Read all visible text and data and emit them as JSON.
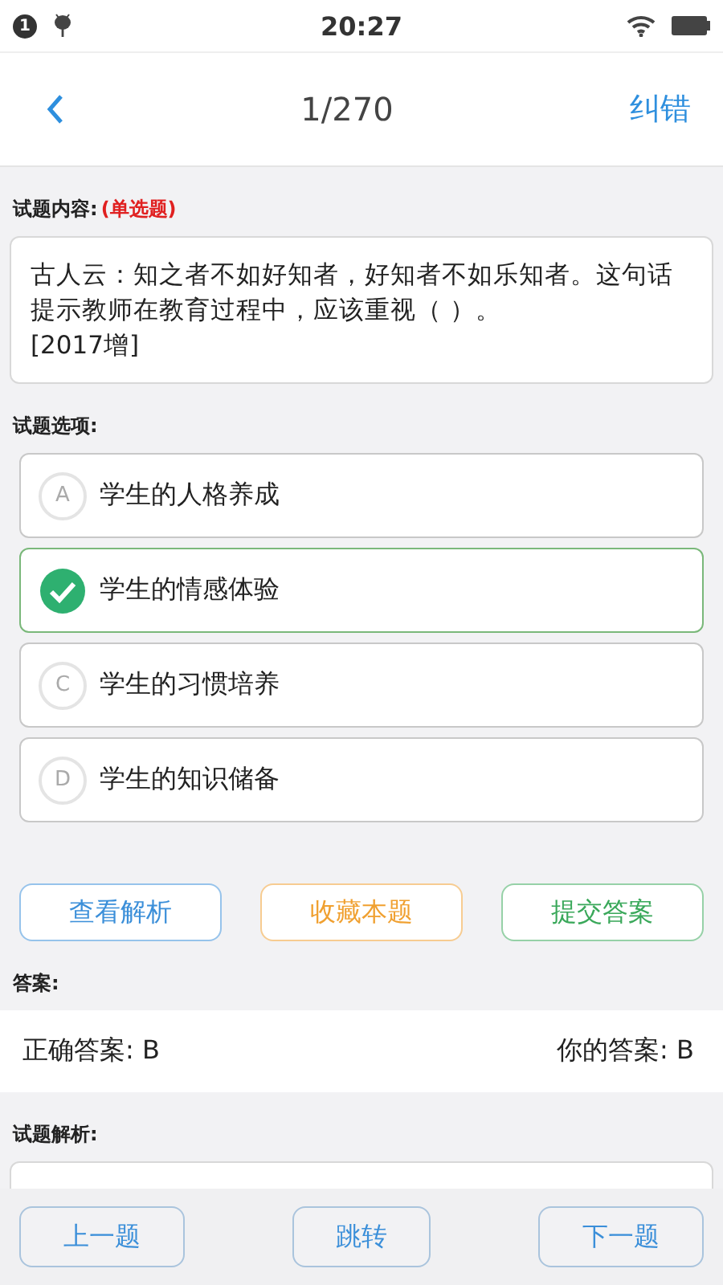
{
  "status_bar": {
    "notification_count": "1",
    "time": "20:27"
  },
  "nav": {
    "progress": "1/270",
    "action": "纠错"
  },
  "question": {
    "label": "试题内容:",
    "type": "(单选题)",
    "text": "古人云：知之者不如好知者，好知者不如乐知者。这句话提示教师在教育过程中，应该重视（ ）。",
    "source": "[2017增]"
  },
  "options_label": "试题选项:",
  "options": [
    {
      "letter": "A",
      "text": "学生的人格养成",
      "selected": false
    },
    {
      "text": "学生的情感体验",
      "selected": true
    },
    {
      "letter": "C",
      "text": "学生的习惯培养",
      "selected": false
    },
    {
      "letter": "D",
      "text": "学生的知识储备",
      "selected": false
    }
  ],
  "actions": [
    {
      "label": "查看解析",
      "color": "#3b8fd9"
    },
    {
      "label": "收藏本题",
      "color": "#f0a030"
    },
    {
      "label": "提交答案",
      "color": "#3aa85a"
    }
  ],
  "answer": {
    "label": "答案:",
    "correct": "正确答案: B",
    "yours": "你的答案: B"
  },
  "analysis_label": "试题解析:",
  "bottom_bar": [
    "上一题",
    "跳转",
    "下一题"
  ]
}
